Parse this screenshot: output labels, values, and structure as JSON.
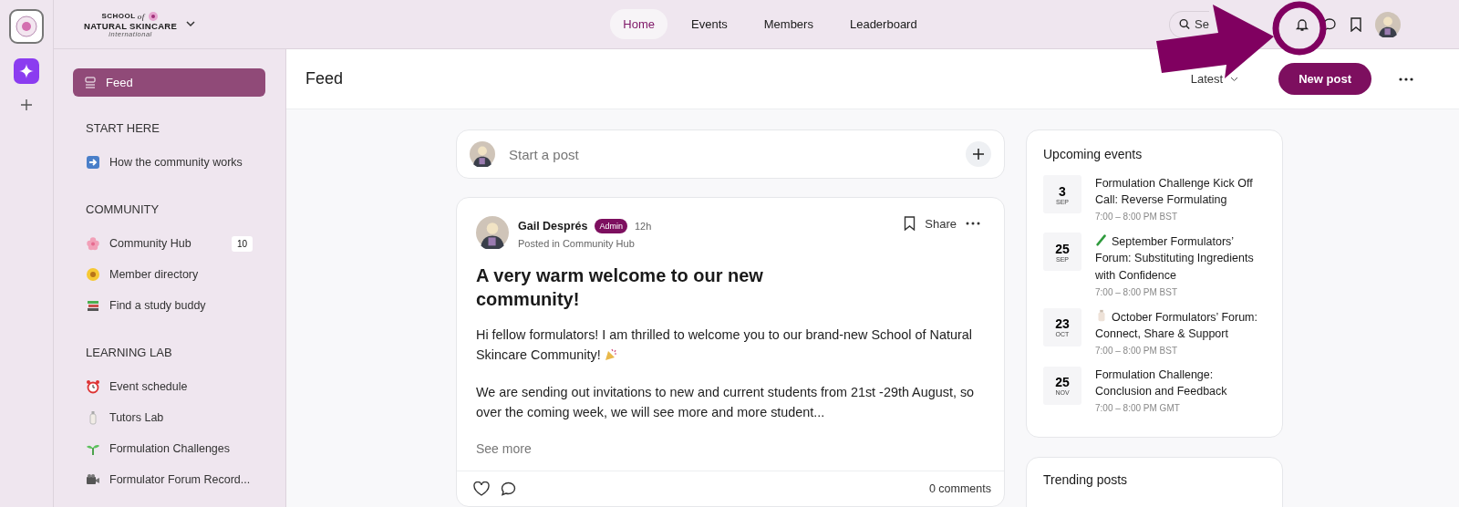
{
  "header": {
    "logo": {
      "lines": [
        "SCHOOL",
        "of",
        "NATURAL SKINCARE",
        "international"
      ]
    },
    "nav": [
      {
        "label": "Home",
        "selected": true
      },
      {
        "label": "Events",
        "selected": false
      },
      {
        "label": "Members",
        "selected": false
      },
      {
        "label": "Leaderboard",
        "selected": false
      }
    ],
    "search": {
      "placeholder": "Se"
    }
  },
  "annotation": {
    "kind": "arrow-circle"
  },
  "sidebar": {
    "feed": {
      "label": "Feed",
      "selected": true
    },
    "sections": [
      {
        "title": "START HERE",
        "items": [
          {
            "label": "How the community works",
            "selected": false
          }
        ]
      },
      {
        "title": "COMMUNITY",
        "items": [
          {
            "label": "Community Hub",
            "selected": false,
            "badge": "10"
          },
          {
            "label": "Member directory",
            "selected": false
          },
          {
            "label": "Find a study buddy",
            "selected": false
          }
        ]
      },
      {
        "title": "LEARNING LAB",
        "items": [
          {
            "label": "Event schedule",
            "selected": false
          },
          {
            "label": "Tutors Lab",
            "selected": false
          },
          {
            "label": "Formulation Challenges",
            "selected": false
          },
          {
            "label": "Formulator Forum Record...",
            "selected": false
          }
        ]
      }
    ]
  },
  "feed": {
    "title": "Feed",
    "sort": "Latest",
    "new_post": "New post"
  },
  "composer": {
    "placeholder": "Start a post"
  },
  "post": {
    "author": "Gail Després",
    "role": "Admin",
    "time": "12h",
    "posted_in": "Posted in Community Hub",
    "title": "A very warm welcome to our new community!",
    "paragraphs": [
      "Hi fellow formulators! I am thrilled to welcome you to our brand-new School of Natural Skincare Community!",
      "We are sending out invitations to new and current students from 21st -29th August, so over the coming week, we will see more and more student..."
    ],
    "see_more": "See more",
    "share": "Share",
    "comments": "0 comments"
  },
  "events": {
    "title": "Upcoming events",
    "items": [
      {
        "day": "3",
        "month": "SEP",
        "title": "Formulation Challenge Kick Off Call: Reverse Formulating",
        "time": "7:00 – 8:00 PM BST"
      },
      {
        "day": "25",
        "month": "SEP",
        "title": "September Formulators’ Forum: Substituting Ingredients with Confidence",
        "time": "7:00 – 8:00 PM BST"
      },
      {
        "day": "23",
        "month": "OCT",
        "title": "October Formulators’ Forum: Connect, Share & Support",
        "time": "7:00 – 8:00 PM BST"
      },
      {
        "day": "25",
        "month": "NOV",
        "title": "Formulation Challenge: Conclusion and Feedback",
        "time": "7:00 – 8:00 PM GMT"
      }
    ]
  },
  "trending": {
    "title": "Trending posts"
  }
}
